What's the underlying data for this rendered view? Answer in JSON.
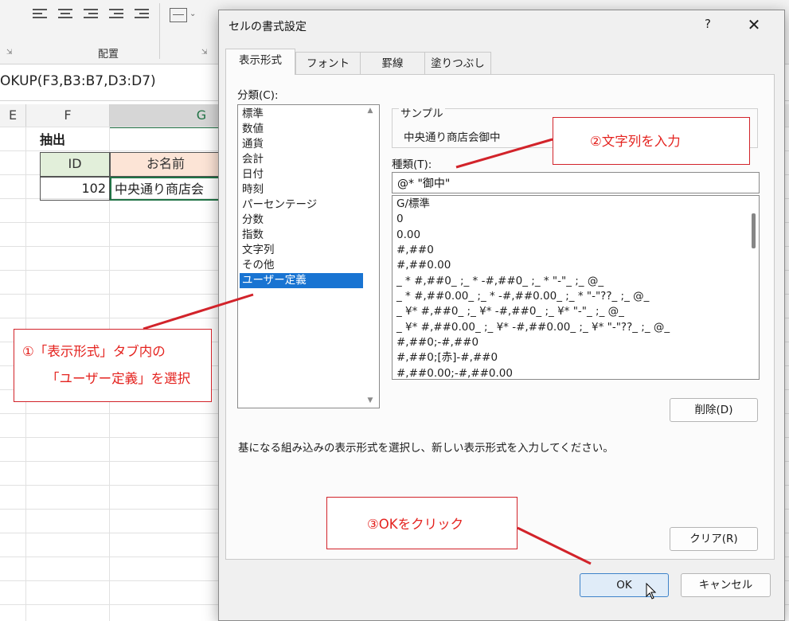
{
  "excel": {
    "ribbon": {
      "alignment_group_label": "配置"
    },
    "formula_bar_text": "OKUP(F3,B3:B7,D3:D7)",
    "columns": [
      "E",
      "F",
      "G"
    ],
    "cells": {
      "extract_label": "抽出",
      "id_header": "ID",
      "name_header": "お名前",
      "id_value": "102",
      "name_value": "中央通り商店会"
    }
  },
  "dialog": {
    "title": "セルの書式設定",
    "help_label": "?",
    "close_label": "✕",
    "tabs": [
      "表示形式",
      "フォント",
      "罫線",
      "塗りつぶし"
    ],
    "active_tab": "表示形式",
    "category_label": "分類(C):",
    "categories": [
      "標準",
      "数値",
      "通貨",
      "会計",
      "日付",
      "時刻",
      "パーセンテージ",
      "分数",
      "指数",
      "文字列",
      "その他",
      "ユーザー定義"
    ],
    "selected_category": "ユーザー定義",
    "sample_label": "サンプル",
    "sample_value": "中央通り商店会御中",
    "type_label": "種類(T):",
    "type_value": "@* \"御中\"",
    "format_list": [
      "G/標準",
      "0",
      "0.00",
      "#,##0",
      "#,##0.00",
      "_ * #,##0_ ;_ * -#,##0_ ;_ * \"-\"_ ;_ @_",
      "_ * #,##0.00_ ;_ * -#,##0.00_ ;_ * \"-\"??_ ;_ @_",
      "_ ¥* #,##0_ ;_ ¥* -#,##0_ ;_ ¥* \"-\"_ ;_ @_",
      "_ ¥* #,##0.00_ ;_ ¥* -#,##0.00_ ;_ ¥* \"-\"??_ ;_ @_",
      "#,##0;-#,##0",
      "#,##0;[赤]-#,##0",
      "#,##0.00;-#,##0.00"
    ],
    "delete_button": "削除(D)",
    "description": "基になる組み込みの表示形式を選択し、新しい表示形式を入力してください。",
    "clear_button": "クリア(R)",
    "ok_button": "OK",
    "cancel_button": "キャンセル"
  },
  "annotations": {
    "step1_line1": "①「表示形式」タブ内の",
    "step1_line2": "「ユーザー定義」を選択",
    "step2": "②文字列を入力",
    "step3": "③OKをクリック",
    "accent_color": "#e4231f"
  }
}
